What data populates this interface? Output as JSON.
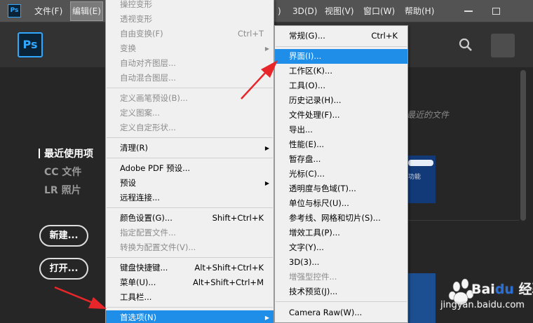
{
  "menubar": {
    "app_icon": "Ps",
    "items": [
      "文件(F)",
      "编辑(E)",
      "",
      "3D(D)",
      "视图(V)",
      "窗口(W)",
      "帮助(H)"
    ],
    "partial_item": ")"
  },
  "home": {
    "logo_text": "Ps",
    "nav": [
      "最近使用项",
      "CC 文件",
      "LR 照片"
    ],
    "new_button": "新建...",
    "open_button": "打开...",
    "recent_hint": "选最近的文件",
    "thumb_label": "功能"
  },
  "edit_menu": {
    "items": [
      {
        "label": "操控变形",
        "shortcut": "",
        "disabled": true
      },
      {
        "label": "透视变形",
        "shortcut": "",
        "disabled": true
      },
      {
        "label": "自由变换(F)",
        "shortcut": "Ctrl+T",
        "disabled": true
      },
      {
        "label": "变换",
        "shortcut": "",
        "disabled": true,
        "submenu": true
      },
      {
        "label": "自动对齐图层...",
        "shortcut": "",
        "disabled": true
      },
      {
        "label": "自动混合图层...",
        "shortcut": "",
        "disabled": true
      },
      {
        "label": "定义画笔预设(B)...",
        "shortcut": "",
        "disabled": true
      },
      {
        "label": "定义图案...",
        "shortcut": "",
        "disabled": true
      },
      {
        "label": "定义自定形状...",
        "shortcut": "",
        "disabled": true
      },
      {
        "label": "清理(R)",
        "shortcut": "",
        "disabled": false,
        "submenu": true
      },
      {
        "label": "Adobe PDF 预设...",
        "shortcut": "",
        "disabled": false
      },
      {
        "label": "预设",
        "shortcut": "",
        "disabled": false,
        "submenu": true
      },
      {
        "label": "远程连接...",
        "shortcut": "",
        "disabled": false
      },
      {
        "label": "颜色设置(G)...",
        "shortcut": "Shift+Ctrl+K",
        "disabled": false
      },
      {
        "label": "指定配置文件...",
        "shortcut": "",
        "disabled": true
      },
      {
        "label": "转换为配置文件(V)...",
        "shortcut": "",
        "disabled": true
      },
      {
        "label": "键盘快捷键...",
        "shortcut": "Alt+Shift+Ctrl+K",
        "disabled": false
      },
      {
        "label": "菜单(U)...",
        "shortcut": "Alt+Shift+Ctrl+M",
        "disabled": false
      },
      {
        "label": "工具栏...",
        "shortcut": "",
        "disabled": false
      },
      {
        "label": "首选项(N)",
        "shortcut": "",
        "disabled": false,
        "submenu": true,
        "highlighted": true
      }
    ]
  },
  "pref_menu": {
    "items": [
      {
        "label": "常规(G)...",
        "shortcut": "Ctrl+K",
        "disabled": false
      },
      {
        "label": "界面(I)...",
        "shortcut": "",
        "disabled": false,
        "highlighted": true
      },
      {
        "label": "工作区(K)...",
        "shortcut": "",
        "disabled": false
      },
      {
        "label": "工具(O)...",
        "shortcut": "",
        "disabled": false
      },
      {
        "label": "历史记录(H)...",
        "shortcut": "",
        "disabled": false
      },
      {
        "label": "文件处理(F)...",
        "shortcut": "",
        "disabled": false
      },
      {
        "label": "导出...",
        "shortcut": "",
        "disabled": false
      },
      {
        "label": "性能(E)...",
        "shortcut": "",
        "disabled": false
      },
      {
        "label": "暂存盘...",
        "shortcut": "",
        "disabled": false
      },
      {
        "label": "光标(C)...",
        "shortcut": "",
        "disabled": false
      },
      {
        "label": "透明度与色域(T)...",
        "shortcut": "",
        "disabled": false
      },
      {
        "label": "单位与标尺(U)...",
        "shortcut": "",
        "disabled": false
      },
      {
        "label": "参考线、网格和切片(S)...",
        "shortcut": "",
        "disabled": false
      },
      {
        "label": "增效工具(P)...",
        "shortcut": "",
        "disabled": false
      },
      {
        "label": "文字(Y)...",
        "shortcut": "",
        "disabled": false
      },
      {
        "label": "3D(3)...",
        "shortcut": "",
        "disabled": false
      },
      {
        "label": "增强型控件...",
        "shortcut": "",
        "disabled": true
      },
      {
        "label": "技术预览(J)...",
        "shortcut": "",
        "disabled": false
      },
      {
        "label": "Camera Raw(W)...",
        "shortcut": "",
        "disabled": false
      }
    ]
  },
  "watermark": {
    "brand": "Bai",
    "brand2": "经验",
    "url": "jingyan.baidu.com"
  },
  "colors": {
    "highlight": "#1e8ee8",
    "annotation_arrow": "#e8262a",
    "ps_blue": "#31a8ff"
  }
}
